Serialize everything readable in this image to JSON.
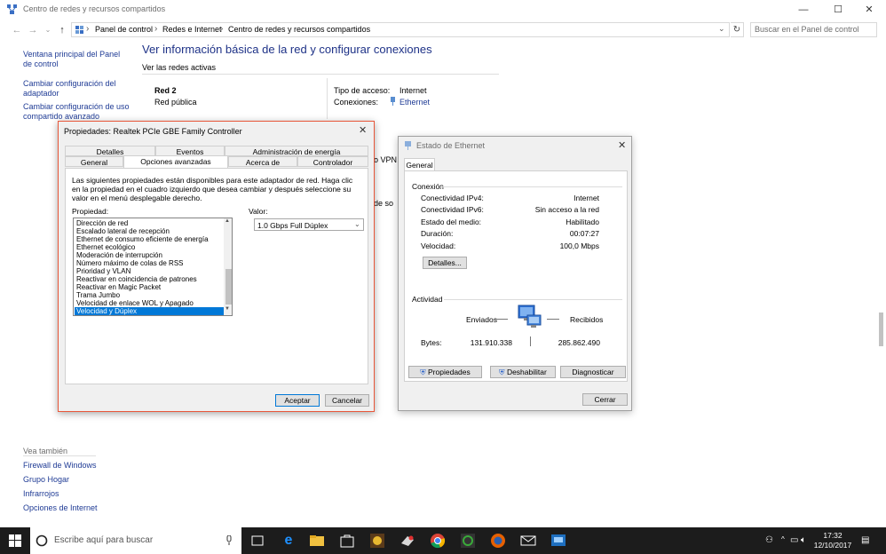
{
  "window": {
    "title": "Centro de redes y recursos compartidos",
    "minimize": "—",
    "maximize": "☐",
    "close": "✕"
  },
  "address": {
    "crumbs": [
      "Panel de control",
      "Redes e Internet",
      "Centro de redes y recursos compartidos"
    ],
    "search_placeholder": "Buscar en el Panel de control"
  },
  "sidebar": {
    "links": [
      "Ventana principal del Panel de control",
      "Cambiar configuración del adaptador",
      "Cambiar configuración de uso compartido avanzado"
    ],
    "see_also": "Vea también",
    "see_also_links": [
      "Firewall de Windows",
      "Grupo Hogar",
      "Infrarrojos",
      "Opciones de Internet"
    ]
  },
  "main": {
    "heading": "Ver información básica de la red y configurar conexiones",
    "active_networks": "Ver las redes activas",
    "network_name": "Red  2",
    "network_type": "Red pública",
    "access_label": "Tipo de acceso:",
    "access_value": "Internet",
    "connections_label": "Conexiones:",
    "connections_value": "Ethernet",
    "fragment_1": "o VPN",
    "fragment_2": "de so"
  },
  "props": {
    "title": "Propiedades: Realtek PCIe GBE Family Controller",
    "tabs_row1": [
      "Detalles",
      "Eventos",
      "Administración de energía"
    ],
    "tabs_row2": [
      "General",
      "Opciones avanzadas",
      "Acerca de",
      "Controlador"
    ],
    "description": "Las siguientes propiedades están disponibles para este adaptador de red. Haga clic en la propiedad en el cuadro izquierdo que desea cambiar y después seleccione su valor en el menú desplegable derecho.",
    "property_label": "Propiedad:",
    "value_label": "Valor:",
    "properties": [
      "Dirección de red",
      "Escalado lateral de recepción",
      "Ethernet de consumo eficiente de energía",
      "Ethernet ecológico",
      "Moderación de interrupción",
      "Número máximo de colas de RSS",
      "Prioridad y VLAN",
      "Reactivar en coincidencia de patrones",
      "Reactivar en Magic Packet",
      "Trama Jumbo",
      "Velocidad de enlace WOL y Apagado",
      "Velocidad y Dúplex"
    ],
    "selected_value": "1.0 Gbps Full Dúplex",
    "ok": "Aceptar",
    "cancel": "Cancelar"
  },
  "eth": {
    "title": "Estado de Ethernet",
    "tab": "General",
    "connection_group": "Conexión",
    "rows": [
      {
        "label": "Conectividad IPv4:",
        "value": "Internet"
      },
      {
        "label": "Conectividad IPv6:",
        "value": "Sin acceso a la red"
      },
      {
        "label": "Estado del medio:",
        "value": "Habilitado"
      },
      {
        "label": "Duración:",
        "value": "00:07:27"
      },
      {
        "label": "Velocidad:",
        "value": "100,0 Mbps"
      }
    ],
    "details_btn": "Detalles...",
    "activity_group": "Actividad",
    "sent": "Enviados",
    "received": "Recibidos",
    "bytes_label": "Bytes:",
    "bytes_sent": "131.910.338",
    "bytes_received": "285.862.490",
    "btn_props": "Propiedades",
    "btn_disable": "Deshabilitar",
    "btn_diagnose": "Diagnosticar",
    "btn_close": "Cerrar"
  },
  "taskbar": {
    "search_placeholder": "Escribe aquí para buscar",
    "time": "17:32",
    "date": "12/10/2017"
  }
}
